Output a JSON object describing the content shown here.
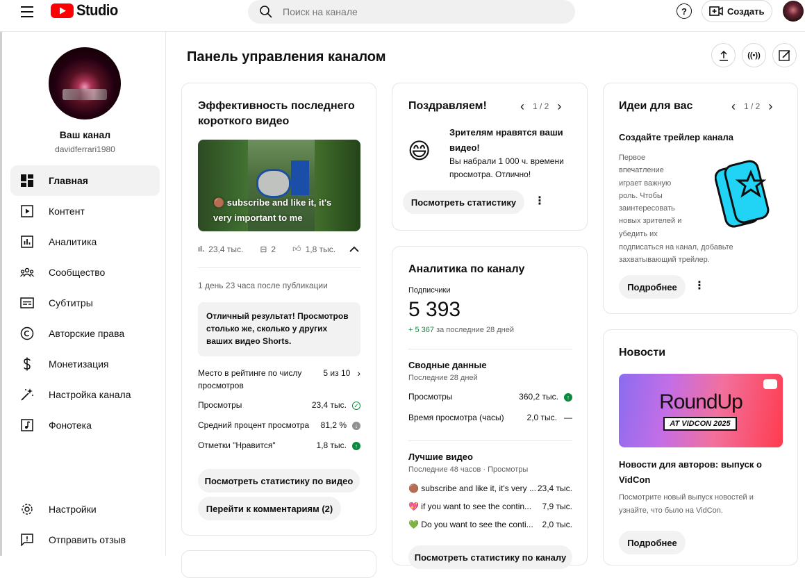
{
  "header": {
    "logo_text": "Studio",
    "search_placeholder": "Поиск на канале",
    "help_label": "?",
    "create_label": "Создать"
  },
  "sidebar": {
    "channel_name": "Ваш канал",
    "channel_handle": "davidferrari1980",
    "items": [
      {
        "label": "Главная",
        "icon": "dashboard-icon"
      },
      {
        "label": "Контент",
        "icon": "content-icon"
      },
      {
        "label": "Аналитика",
        "icon": "analytics-icon"
      },
      {
        "label": "Сообщество",
        "icon": "community-icon"
      },
      {
        "label": "Субтитры",
        "icon": "subtitles-icon"
      },
      {
        "label": "Авторские права",
        "icon": "copyright-icon"
      },
      {
        "label": "Монетизация",
        "icon": "monetization-icon"
      },
      {
        "label": "Настройка канала",
        "icon": "customization-icon"
      },
      {
        "label": "Фонотека",
        "icon": "audio-library-icon"
      }
    ],
    "bottom_items": [
      {
        "label": "Настройки",
        "icon": "settings-icon"
      },
      {
        "label": "Отправить отзыв",
        "icon": "feedback-icon"
      }
    ]
  },
  "main": {
    "title": "Панель управления каналом"
  },
  "latest_short": {
    "title": "Эффективность последнего короткого видео",
    "video_caption": "🟤 subscribe and like it, it's very important to me",
    "stats": {
      "views": "23,4 тыс.",
      "comments": "2",
      "likes": "1,8 тыс."
    },
    "published": "1 день 23 часа после публикации",
    "highlight": "Отличный результат! Просмотров столько же, сколько у других ваших видео Shorts.",
    "rows": [
      {
        "label": "Место в рейтинге по числу просмотров",
        "value": "5 из 10"
      },
      {
        "label": "Просмотры",
        "value": "23,4 тыс."
      },
      {
        "label": "Средний процент просмотра",
        "value": "81,2 %"
      },
      {
        "label": "Отметки \"Нравится\"",
        "value": "1,8 тыс."
      }
    ],
    "btn_stats": "Посмотреть статистику по видео",
    "btn_comments": "Перейти к комментариям (2)"
  },
  "congrats": {
    "title": "Поздравляем!",
    "pager": "1 / 2",
    "emoji": "😄",
    "headline": "Зрителям нравятся ваши видео!",
    "text": "Вы набрали 1 000 ч. времени просмотра. Отлично!",
    "btn": "Посмотреть статистику"
  },
  "analytics": {
    "title": "Аналитика по каналу",
    "subs_label": "Подписчики",
    "subs_value": "5 393",
    "subs_delta": "+ 5 367",
    "subs_period": "за последние 28 дней",
    "summary_title": "Сводные данные",
    "summary_period": "Последние 28 дней",
    "summary_rows": [
      {
        "label": "Просмотры",
        "value": "360,2 тыс."
      },
      {
        "label": "Время просмотра (часы)",
        "value": "2,0 тыс."
      }
    ],
    "top_title": "Лучшие видео",
    "top_period": "Последние 48 часов · Просмотры",
    "top_videos": [
      {
        "title": "🟤 subscribe and like it, it's very ...",
        "value": "23,4 тыс."
      },
      {
        "title": "💖 if you want to see the contin...",
        "value": "7,9 тыс."
      },
      {
        "title": "💚 Do you want to see the conti...",
        "value": "2,0 тыс."
      }
    ],
    "btn": "Посмотреть статистику по каналу"
  },
  "ideas": {
    "title": "Идеи для вас",
    "pager": "1 / 2",
    "subtitle": "Создайте трейлер канала",
    "text_narrow": "Первое впечатление играет важную роль. Чтобы заинтересовать новых зрителей и убедить их",
    "text_wide": "подписаться на канал, добавьте захватывающий трейлер.",
    "btn": "Подробнее"
  },
  "news": {
    "title": "Новости",
    "banner_main": "RoundUp",
    "banner_sub": "AT VIDCON 2025",
    "headline": "Новости для авторов: выпуск о VidCon",
    "text": "Посмотрите новый выпуск новостей и узнайте, что было на VidCon.",
    "btn": "Подробнее"
  },
  "colors": {
    "brand_red": "#ff0000",
    "positive_green": "#0a8a3c",
    "accent_cyan": "#21d4f5"
  }
}
